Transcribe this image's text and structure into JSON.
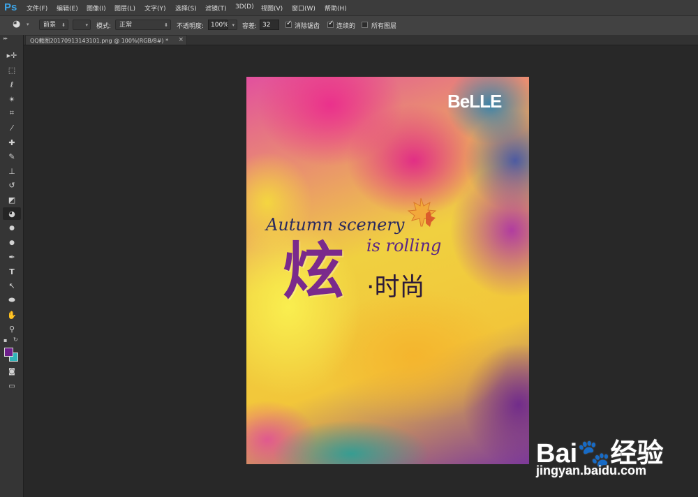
{
  "app": {
    "logo": "Ps"
  },
  "menu": [
    "文件(F)",
    "编辑(E)",
    "图像(I)",
    "图层(L)",
    "文字(Y)",
    "选择(S)",
    "滤镜(T)",
    "3D(D)",
    "视图(V)",
    "窗口(W)",
    "帮助(H)"
  ],
  "options": {
    "tool_icon": "paint-bucket-icon",
    "fill_source": "前景",
    "mode_label": "模式:",
    "mode_value": "正常",
    "opacity_label": "不透明度:",
    "opacity_value": "100%",
    "tolerance_label": "容差:",
    "tolerance_value": "32",
    "antialias_label": "消除锯齿",
    "antialias_checked": true,
    "contiguous_label": "连续的",
    "contiguous_checked": true,
    "all_layers_label": "所有图层",
    "all_layers_checked": false
  },
  "document": {
    "tab_title": "QQ截图20170913143101.png @ 100%(RGB/8#) *",
    "close": "×"
  },
  "tools": [
    {
      "name": "move-tool",
      "glyph": "▸✛"
    },
    {
      "name": "marquee-tool",
      "glyph": "⬚"
    },
    {
      "name": "lasso-tool",
      "glyph": "ℓ"
    },
    {
      "name": "magic-wand-tool",
      "glyph": "✴"
    },
    {
      "name": "crop-tool",
      "glyph": "⌗"
    },
    {
      "name": "eyedropper-tool",
      "glyph": "⁄"
    },
    {
      "name": "healing-brush-tool",
      "glyph": "✚"
    },
    {
      "name": "brush-tool",
      "glyph": "✎"
    },
    {
      "name": "clone-stamp-tool",
      "glyph": "⊥"
    },
    {
      "name": "history-brush-tool",
      "glyph": "↺"
    },
    {
      "name": "eraser-tool",
      "glyph": "◩"
    },
    {
      "name": "paint-bucket-tool",
      "glyph": "◕",
      "active": true
    },
    {
      "name": "blur-tool",
      "glyph": "●"
    },
    {
      "name": "dodge-tool",
      "glyph": "●"
    },
    {
      "name": "pen-tool",
      "glyph": "✒"
    },
    {
      "name": "type-tool",
      "glyph": "T"
    },
    {
      "name": "path-selection-tool",
      "glyph": "↖"
    },
    {
      "name": "ellipse-tool",
      "glyph": "⬬"
    },
    {
      "name": "hand-tool",
      "glyph": "✋"
    },
    {
      "name": "zoom-tool",
      "glyph": "⚲"
    }
  ],
  "colors": {
    "foreground": "#6e1f8c",
    "background": "#2fb3b8"
  },
  "poster": {
    "brand": "BeLLE",
    "line1": "Autumn scenery",
    "line2": "is rolling",
    "big_char": "炫",
    "small_chars": "·时尚"
  },
  "watermark": {
    "logo": "Bai🐾经验",
    "url": "jingyan.baidu.com"
  }
}
